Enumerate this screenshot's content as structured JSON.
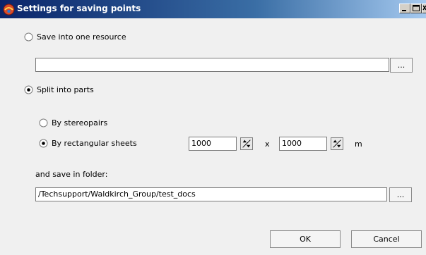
{
  "window": {
    "title": "Settings for saving points"
  },
  "options": {
    "save_one_label": "Save into one resource",
    "one_resource_path": "",
    "browse_label": "...",
    "split_label": "Split into parts",
    "by_stereopairs_label": "By stereopairs",
    "by_sheets_label": "By rectangular sheets",
    "sheet_width": "1000",
    "times_label": "x",
    "sheet_height": "1000",
    "unit_label": "m",
    "folder_label": "and save in folder:",
    "folder_path": "/Techsupport/Waldkirch_Group/test_docs",
    "folder_browse_label": "..."
  },
  "selection": {
    "mode": "split_into_parts",
    "split_method": "by_rectangular_sheets"
  },
  "buttons": {
    "ok": "OK",
    "cancel": "Cancel"
  }
}
